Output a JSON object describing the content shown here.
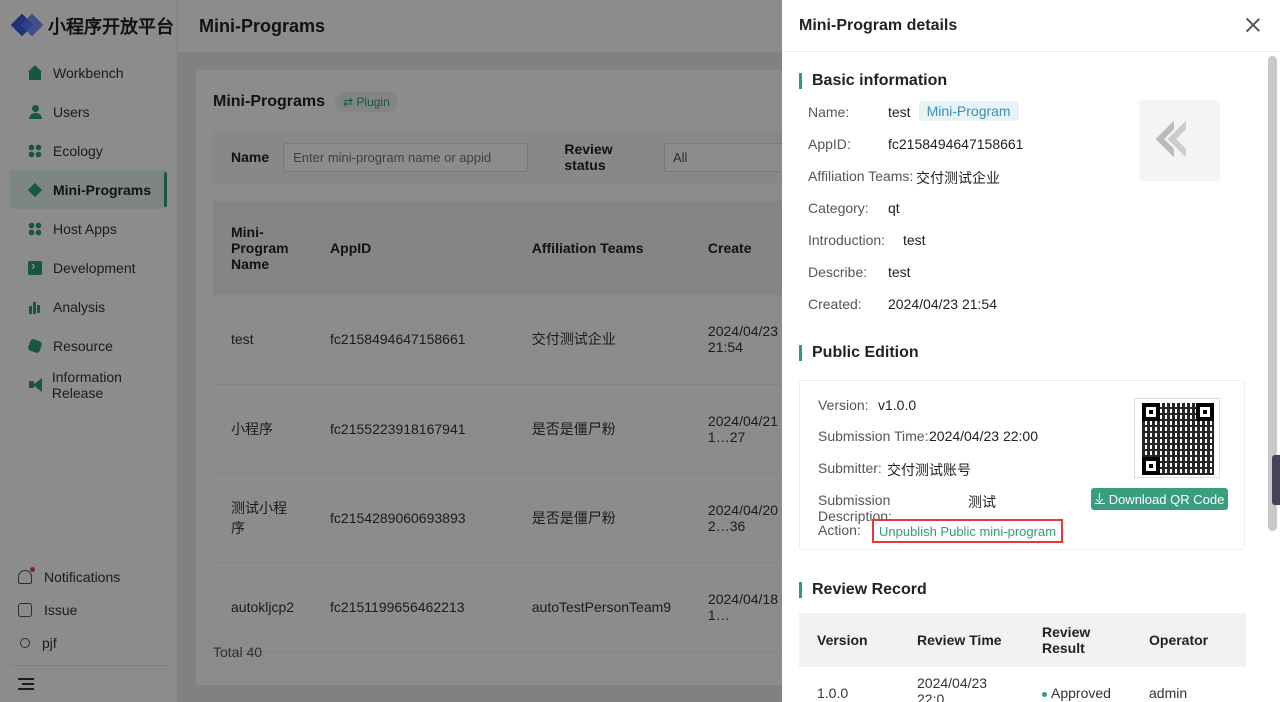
{
  "app": {
    "logo_text": "小程序开放平台"
  },
  "sidebar": {
    "items": [
      {
        "label": "Workbench",
        "icon": "home-icon"
      },
      {
        "label": "Users",
        "icon": "user-icon"
      },
      {
        "label": "Ecology",
        "icon": "grid-icon"
      },
      {
        "label": "Mini-Programs",
        "icon": "diamond-icon",
        "active": true
      },
      {
        "label": "Host Apps",
        "icon": "grid-icon"
      },
      {
        "label": "Development",
        "icon": "terminal-icon"
      },
      {
        "label": "Analysis",
        "icon": "bar-chart-icon"
      },
      {
        "label": "Resource",
        "icon": "hexagon-icon"
      },
      {
        "label": "Information Release",
        "icon": "megaphone-icon"
      }
    ],
    "bottom": {
      "notifications": "Notifications",
      "issue": "Issue",
      "user": "pjf"
    }
  },
  "header": {
    "title": "Mini-Programs"
  },
  "main": {
    "card_title": "Mini-Programs",
    "plugin_tag": "⇄ Plugin",
    "filter": {
      "name_label": "Name",
      "name_placeholder": "Enter mini-program name or appid",
      "status_label": "Review status",
      "status_value": "All"
    },
    "table": {
      "headers": {
        "name": "Mini-Program Name",
        "appid": "AppID",
        "team": "Affiliation Teams",
        "created": "Create"
      },
      "rows": [
        {
          "name": "test",
          "appid": "fc2158494647158661",
          "team": "交付测试企业",
          "created": "2024/04/23 21:54"
        },
        {
          "name": "小程序",
          "appid": "fc2155223918167941",
          "team": "是否是僵尸粉",
          "created": "2024/04/21 1…27"
        },
        {
          "name": "测试小程序",
          "appid": "fc2154289060693893",
          "team": "是否是僵尸粉",
          "created": "2024/04/20 2…36"
        },
        {
          "name": "autokljcp2",
          "appid": "fc2151199656462213",
          "team": "autoTestPersonTeam9",
          "created": "2024/04/18 1…"
        }
      ]
    },
    "total": "Total 40"
  },
  "drawer": {
    "title": "Mini-Program details",
    "basic": {
      "section_title": "Basic information",
      "name_label": "Name:",
      "name_value": "test",
      "type_tag": "Mini-Program",
      "appid_label": "AppID:",
      "appid_value": "fc2158494647158661",
      "team_label": "Affiliation Teams:",
      "team_value": "交付测试企业",
      "category_label": "Category:",
      "category_value": "qt",
      "intro_label": "Introduction:",
      "intro_value": "test",
      "describe_label": "Describe:",
      "describe_value": "test",
      "created_label": "Created:",
      "created_value": "2024/04/23 21:54"
    },
    "public": {
      "section_title": "Public Edition",
      "version_label": "Version:",
      "version_value": "v1.0.0",
      "submission_time_label": "Submission Time:",
      "submission_time_value": "2024/04/23 22:00",
      "submitter_label": "Submitter:",
      "submitter_value": "交付测试账号",
      "description_label": "Submission Description:",
      "description_value": "测试",
      "action_label": "Action:",
      "unpublish_label": "Unpublish Public mini-program",
      "download_label": "Download QR Code"
    },
    "review": {
      "section_title": "Review Record",
      "headers": {
        "version": "Version",
        "time": "Review Time",
        "result": "Review Result",
        "operator": "Operator"
      },
      "rows": [
        {
          "version": "1.0.0",
          "time": "2024/04/23 22:0",
          "result": "Approved",
          "operator": "admin"
        }
      ]
    }
  },
  "colors": {
    "accent": "#2a9d7a",
    "highlight_border": "#e53935",
    "tag_bg": "#e7f3f7"
  }
}
